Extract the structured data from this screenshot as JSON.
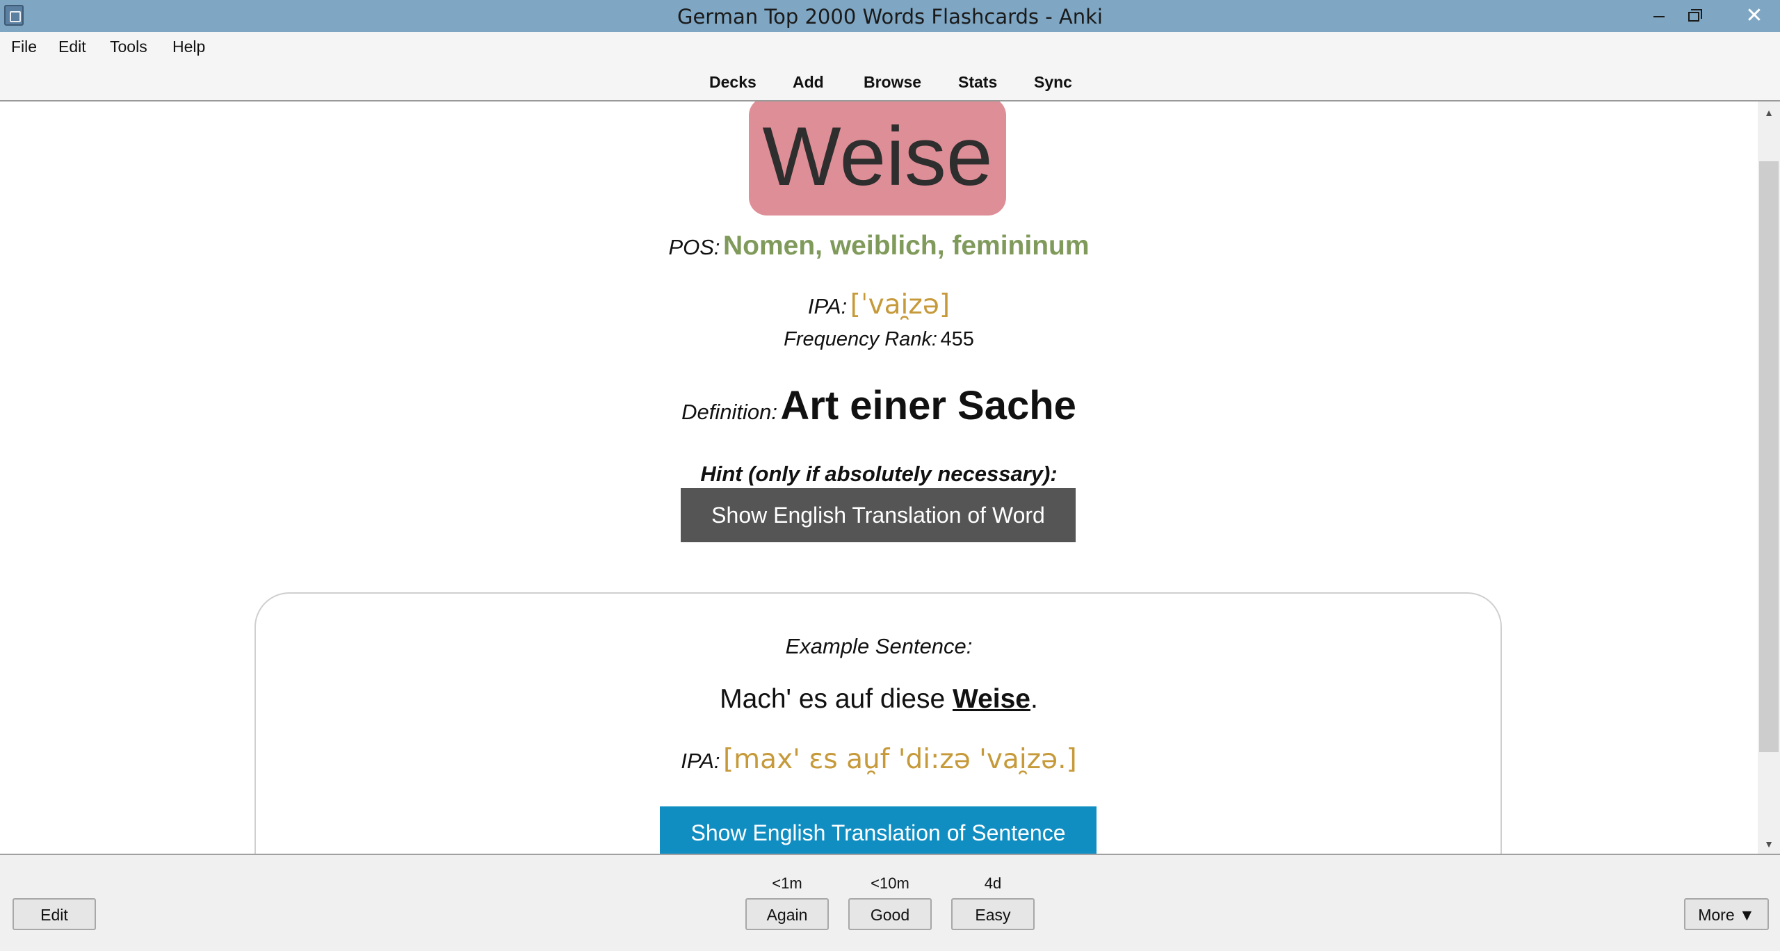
{
  "window": {
    "title": "German Top 2000 Words Flashcards - Anki",
    "minimize_glyph": "",
    "maximize_glyph": "",
    "close_glyph": "✕"
  },
  "menu": {
    "file": "File",
    "edit": "Edit",
    "tools": "Tools",
    "help": "Help"
  },
  "toolbar": {
    "decks": "Decks",
    "add": "Add",
    "browse": "Browse",
    "stats": "Stats",
    "sync": "Sync"
  },
  "card": {
    "word": "Weise",
    "pos_label": "POS:",
    "pos_value": "Nomen, weiblich, femininum",
    "ipa_label": "IPA:",
    "ipa_value": "[ˈvai̯zə]",
    "freq_label": "Frequency Rank:",
    "freq_value": "455",
    "def_label": "Definition:",
    "def_value": "Art einer Sache",
    "hint_label": "Hint (only if absolutely necessary):",
    "show_word_translation": "Show English Translation of Word",
    "example_label": "Example Sentence:",
    "example_before": "Mach' es auf diese ",
    "example_word": "Weise",
    "example_after": ".",
    "example_ipa_label": "IPA:",
    "example_ipa_value": "[max' ɛs au̯f 'di:zə 'vai̯zə.]",
    "show_sentence_translation": "Show English Translation of Sentence"
  },
  "bottom": {
    "edit": "Edit",
    "again_interval": "<1m",
    "again": "Again",
    "good_interval": "<10m",
    "good": "Good",
    "easy_interval": "4d",
    "easy": "Easy",
    "more": "More ▼"
  },
  "colors": {
    "word_bg": "#de8e96",
    "pos": "#7f9a5a",
    "ipa": "#c69a3a",
    "word_button": "#555555",
    "sentence_button": "#108ec2",
    "titlebar": "#7fa7c4",
    "close_button": "#ffffff"
  }
}
